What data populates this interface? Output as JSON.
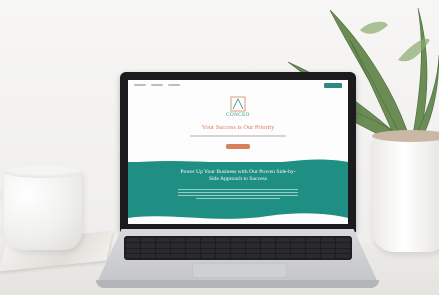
{
  "website": {
    "brand": "CONCEO",
    "tagline": "Your Success is Our Priority",
    "headline": "Power Up Your Business with Our Proven Side-by-Side Approach to Success"
  },
  "colors": {
    "teal": "#1f8f84",
    "accent": "#d4825c"
  }
}
